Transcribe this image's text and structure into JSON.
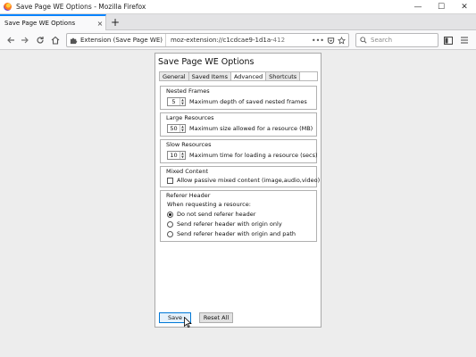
{
  "window": {
    "title": "Save Page WE Options - Mozilla Firefox",
    "minimize": "—",
    "maximize": "☐",
    "close": "✕"
  },
  "tab": {
    "title": "Save Page WE Options",
    "close": "×",
    "new_tab": "+"
  },
  "navbar": {
    "back_icon": "arrow-left-icon",
    "forward_icon": "arrow-right-icon",
    "reload_icon": "reload-icon",
    "home_icon": "home-icon",
    "extension_label": "Extension (Save Page WE)",
    "url_text": "moz-extension://c1cdcae9-1d1a-",
    "url_tail": "412",
    "more": "•••",
    "search_placeholder": "Search"
  },
  "page": {
    "title": "Save Page WE Options",
    "tabs": [
      {
        "label": "General"
      },
      {
        "label": "Saved Items"
      },
      {
        "label": "Advanced"
      },
      {
        "label": "Shortcuts"
      }
    ],
    "nested_frames": {
      "title": "Nested Frames",
      "value": "5",
      "label": "Maximum depth of saved nested frames"
    },
    "large_resources": {
      "title": "Large Resources",
      "value": "50",
      "label": "Maximum size allowed for a resource (MB)"
    },
    "slow_resources": {
      "title": "Slow Resources",
      "value": "10",
      "label": "Maximum time for loading a resource (secs)"
    },
    "mixed_content": {
      "title": "Mixed Content",
      "label": "Allow passive mixed content (image,audio,video)"
    },
    "referer_header": {
      "title": "Referer Header",
      "intro": "When requesting a resource:",
      "options": [
        {
          "label": "Do not send referer header"
        },
        {
          "label": "Send referer header with origin only"
        },
        {
          "label": "Send referer header with origin and path"
        }
      ]
    },
    "save_label": "Save",
    "reset_label": "Reset All"
  }
}
